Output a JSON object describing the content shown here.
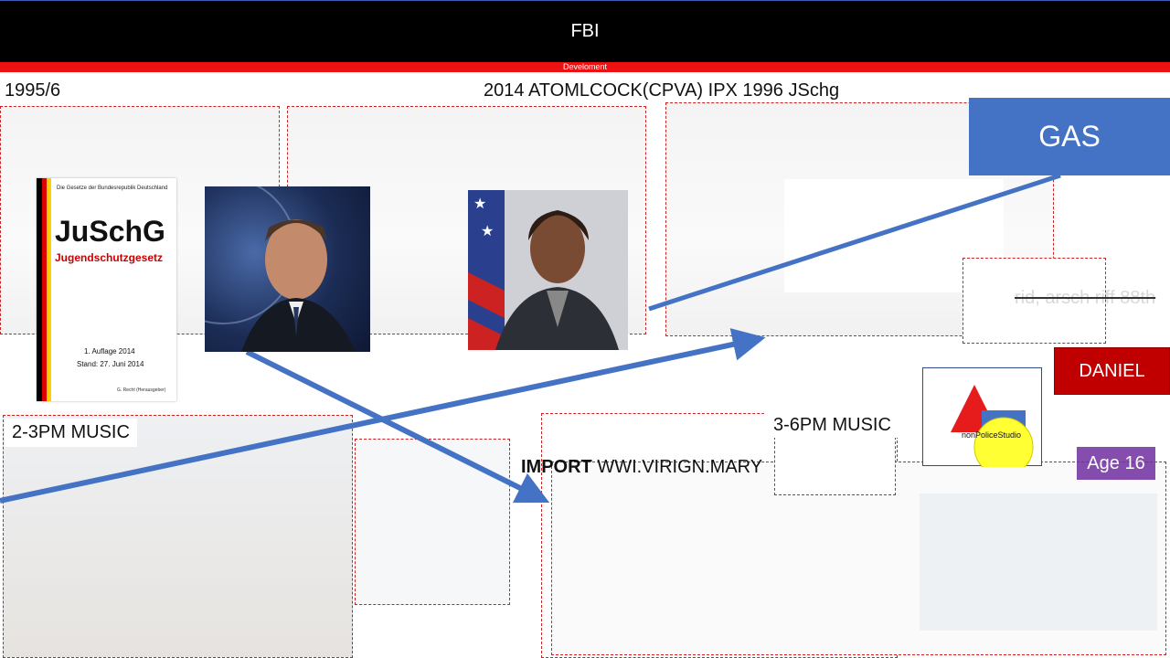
{
  "header": {
    "title": "FBI",
    "subtitle": "Develoment"
  },
  "labels": {
    "top_left": "1995/6",
    "top_center": "2014 ATOMLCOCK(CPVA) IPX 1996 JSchg",
    "music_left": "2-3PM MUSIC",
    "music_right": "3-6PM MUSIC",
    "import_bold": "IMPORT",
    "import_rest": " WWI.VIRIGN.MARY",
    "strike_text": "rid, arsch riff 88th"
  },
  "book": {
    "series": "Die Gesetze der Bundesrepublik Deutschland",
    "title": "JuSchG",
    "subtitle": "Jugendschutzgesetz",
    "edition": "1. Auflage 2014",
    "stand": "Stand: 27. Juni 2014",
    "editor": "G. Recht (Herausgeber)"
  },
  "buttons": {
    "gas": "GAS",
    "daniel": "DANIEL",
    "age": "Age 16"
  },
  "logo": {
    "text": "nonPoliceStudio"
  },
  "colors": {
    "accent_blue": "#4472c4",
    "red_bar": "#ee1111",
    "daniel_red": "#c00000",
    "purple": "#7030a0"
  }
}
